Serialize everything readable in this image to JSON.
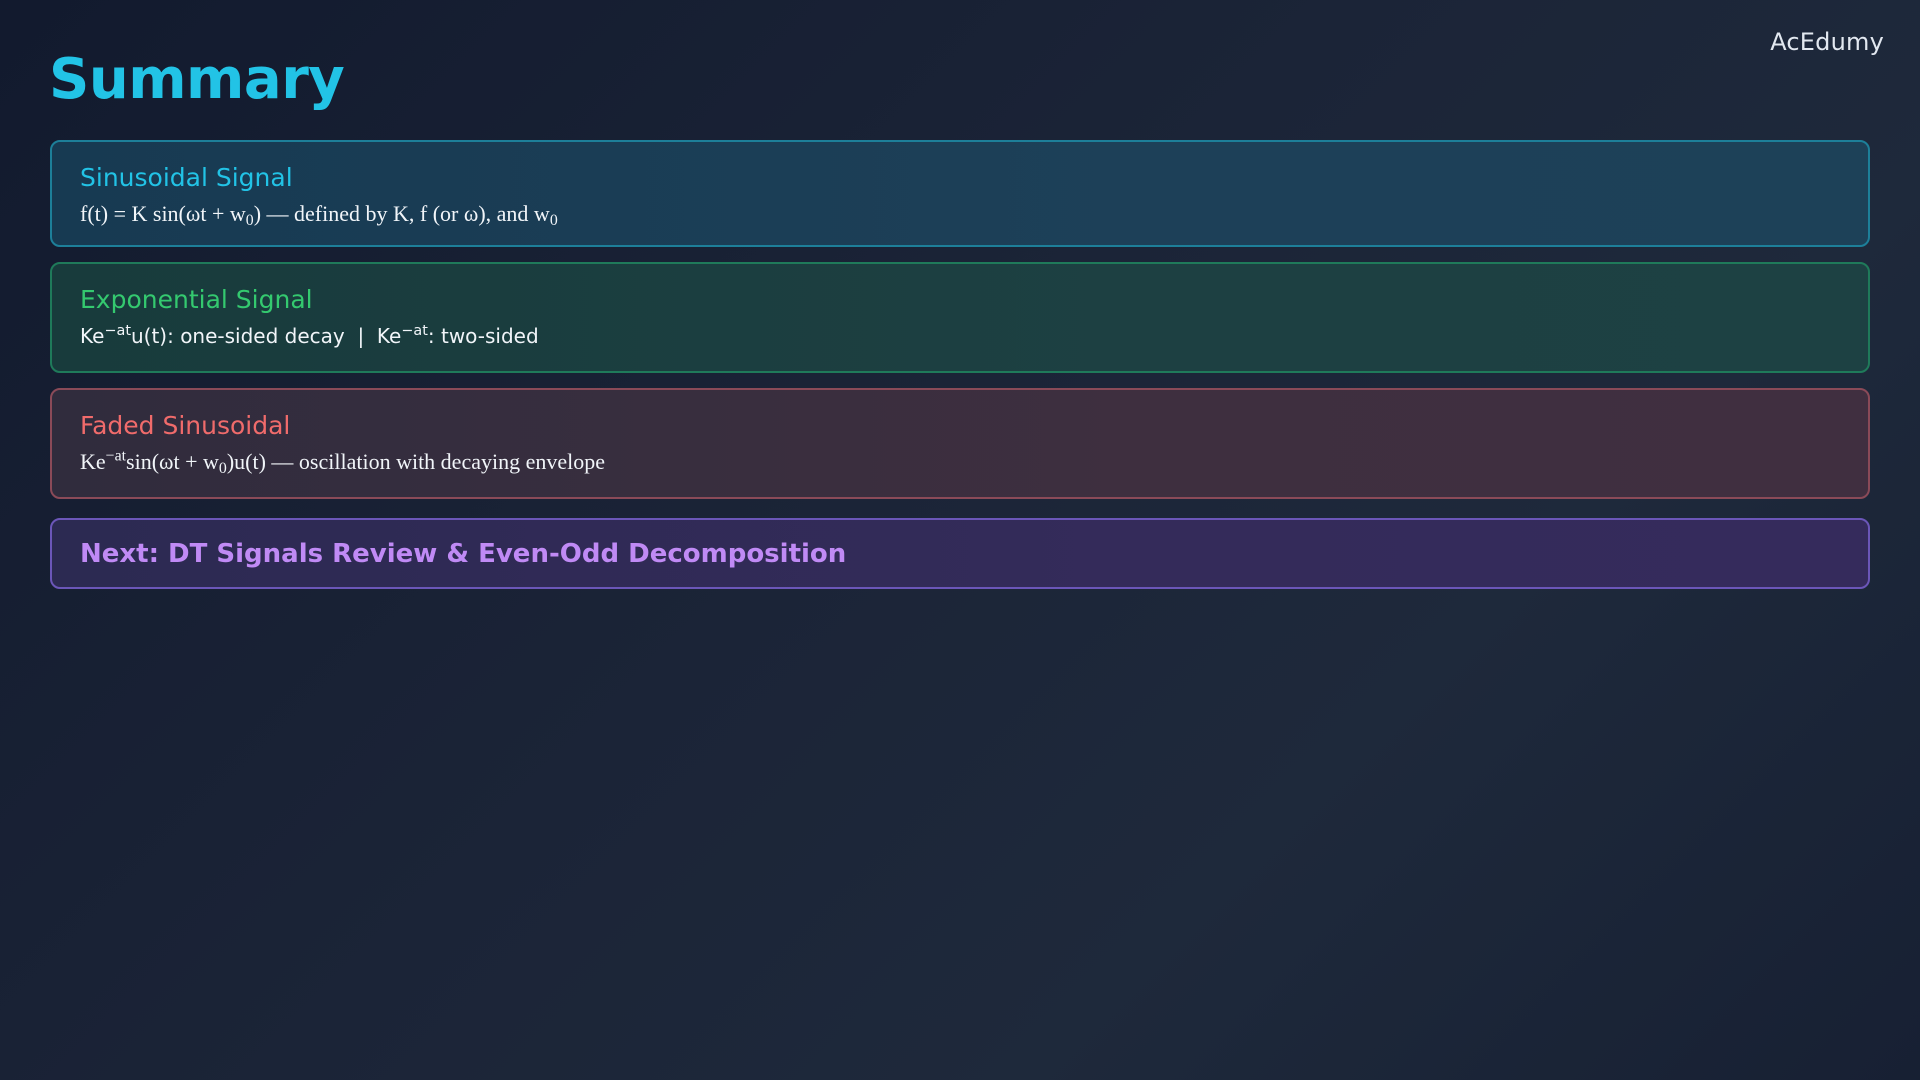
{
  "brand": "AcEdumy",
  "title": "Summary",
  "cards": [
    {
      "title": "Sinusoidal Signal",
      "body": {
        "part1": "f(t) = K sin(ωt + w",
        "sub1": "0",
        "part2": ") — defined by K, f (or ω), and w",
        "sub2": "0"
      }
    },
    {
      "title": "Exponential Signal",
      "body": {
        "part1": "Ke",
        "sup1": "−at",
        "part2": "u(t): one-sided decay  |  Ke",
        "sup2": "−at",
        "part3": ": two-sided"
      }
    },
    {
      "title": "Faded Sinusoidal",
      "body": {
        "part1": "Ke",
        "sup1": "−at",
        "part2": "sin(ωt + w",
        "sub1": "0",
        "part3": ")u(t) — oscillation with decaying envelope"
      }
    },
    {
      "title": "Next: DT Signals Review & Even-Odd Decomposition"
    }
  ],
  "colors": {
    "cyan": "#22c3e6",
    "green": "#34c96f",
    "red": "#f06b6b",
    "purple": "#c08af5"
  }
}
